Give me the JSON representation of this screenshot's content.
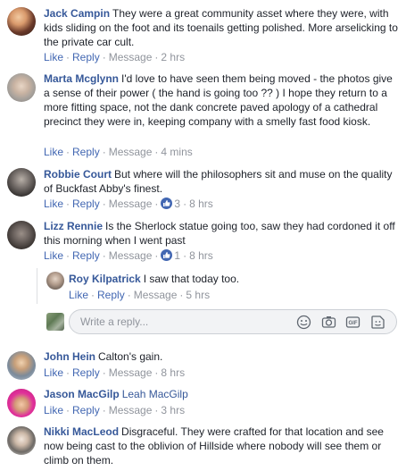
{
  "actions": {
    "like": "Like",
    "reply": "Reply",
    "message": "Message",
    "dot": "·"
  },
  "comments": [
    {
      "name": "Jack Campin",
      "text": "They were a great community asset where they were, with kids sliding on the foot and its toenails getting polished. More arselicking to the private car cult.",
      "time": "2 hrs"
    },
    {
      "name": "Marta Mcglynn",
      "text": "I'd love to have seen them being moved - the photos give a sense of their power ( the hand is going too ?? ) I hope they return to a more fitting space, not the dank concrete paved apology of a cathedral precinct they were in, keeping company with a smelly fast food kiosk.",
      "time": "4 mins"
    },
    {
      "name": "Robbie Court",
      "text": "But where will the philosophers sit and muse on the quality of Buckfast Abby's finest.",
      "likes": "3",
      "time": "8 hrs"
    },
    {
      "name": "Lizz Rennie",
      "text": "Is the Sherlock statue going too, saw they had cordoned it off this morning when I went past",
      "likes": "1",
      "time": "8 hrs"
    },
    {
      "name": "John Hein",
      "text": "Calton's gain.",
      "time": "8 hrs"
    },
    {
      "name": "Jason MacGilp",
      "mention": "Leah MacGilp",
      "time": "3 hrs"
    },
    {
      "name": "Nikki MacLeod",
      "text": "Disgraceful. They were crafted for that location and see now being cast to the oblivion of Hillside where nobody will see them or climb on them."
    }
  ],
  "reply": {
    "name": "Roy Kilpatrick",
    "text": "I saw that today too.",
    "time": "5 hrs"
  },
  "reply_box": {
    "placeholder": "Write a reply..."
  },
  "colors": {
    "link": "#365899",
    "action_link": "#4267b2",
    "meta": "#90949c",
    "like_badge": "#4267b2"
  },
  "icons": [
    "like-badge-icon",
    "emoji-icon",
    "camera-icon",
    "gif-icon",
    "sticker-icon"
  ]
}
